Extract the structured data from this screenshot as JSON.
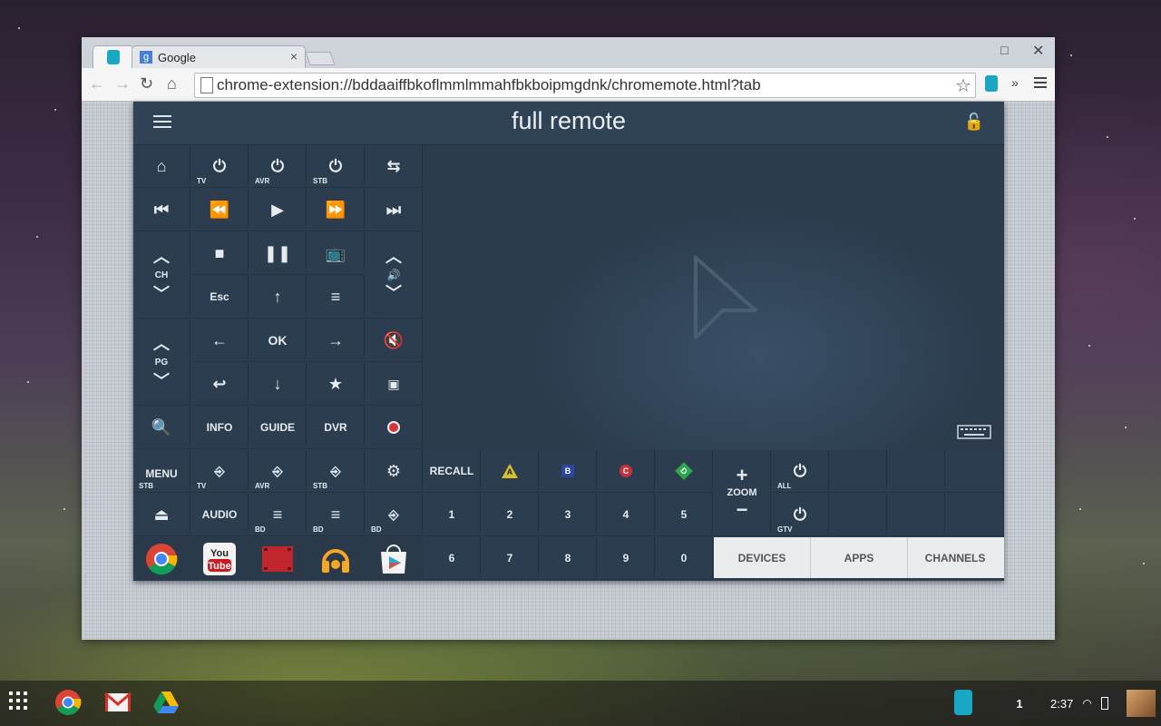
{
  "browser": {
    "tabs": [
      {
        "label": ""
      },
      {
        "label": "Google",
        "close": "×"
      }
    ],
    "url": "chrome-extension://bddaaiffbkoflmmlmmahfbkboipmgdnk/chromemote.html?tab"
  },
  "app": {
    "title": "full remote",
    "grid": {
      "tv_sub": "TV",
      "avr_sub": "AVR",
      "stb_sub": "STB",
      "ch_label": "CH",
      "esc_label": "Esc",
      "ok_label": "OK",
      "pg_label": "PG",
      "info_label": "INFO",
      "guide_label": "GUIDE",
      "dvr_label": "DVR"
    },
    "bottom": {
      "menu_label": "MENU",
      "menu_sub": "STB",
      "input_tv_sub": "TV",
      "input_avr_sub": "AVR",
      "input_stb_sub": "STB",
      "recall_label": "RECALL",
      "color_a": "A",
      "color_b": "B",
      "color_c": "C",
      "color_d": "D",
      "zoom_label": "ZOOM",
      "all_sub": "ALL",
      "gtv_sub": "GTV",
      "audio_label": "AUDIO",
      "bd_sub_1": "BD",
      "bd_sub_2": "BD",
      "bd_sub_3": "BD",
      "digits_row1": [
        "1",
        "2",
        "3",
        "4",
        "5"
      ],
      "digits_row2": [
        "6",
        "7",
        "8",
        "9",
        "0"
      ]
    },
    "tabs": {
      "devices": "DEVICES",
      "apps": "APPS",
      "channels": "CHANNELS"
    },
    "dock_apps": [
      "chrome-icon",
      "youtube-icon",
      "movies-icon",
      "music-icon",
      "play-store-icon"
    ],
    "colors": {
      "accent_bg": "#2c3d4f",
      "record": "#d8363b",
      "a": "#d8c02a",
      "b": "#2c46a0",
      "c": "#c8323a",
      "d": "#2aa84a"
    }
  },
  "shelf": {
    "notification_count": "1",
    "time": "2:37"
  }
}
